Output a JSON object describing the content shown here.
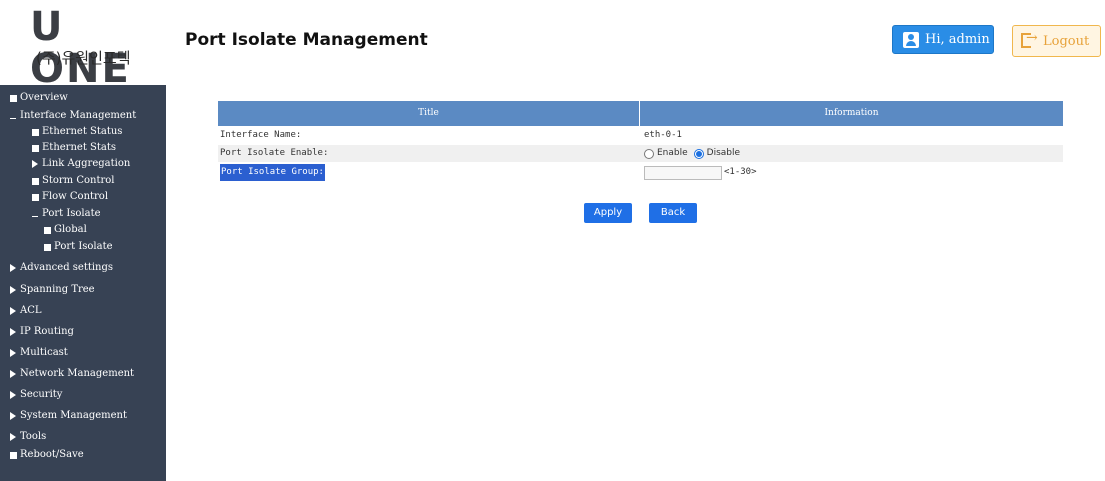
{
  "header": {
    "logo_text": "U ONE",
    "logo_subtitle": "(주)유원인포텍",
    "page_title": "Port Isolate Management",
    "user_button": "Hi, admin",
    "logout_button": "Logout"
  },
  "sidebar": {
    "items": [
      {
        "label": "Overview",
        "marker": "square",
        "level": 0
      },
      {
        "label": "Interface Management",
        "marker": "expanded",
        "level": 0
      },
      {
        "label": "Ethernet Status",
        "marker": "square",
        "level": 1
      },
      {
        "label": "Ethernet Stats",
        "marker": "square",
        "level": 1
      },
      {
        "label": "Link Aggregation",
        "marker": "collapsed",
        "level": 1
      },
      {
        "label": "Storm Control",
        "marker": "square",
        "level": 1
      },
      {
        "label": "Flow Control",
        "marker": "square",
        "level": 1
      },
      {
        "label": "Port Isolate",
        "marker": "expanded",
        "level": 1
      },
      {
        "label": "Global",
        "marker": "square",
        "level": 2
      },
      {
        "label": "Port Isolate",
        "marker": "square",
        "level": 2
      },
      {
        "label": "Advanced settings",
        "marker": "collapsed",
        "level": 0
      },
      {
        "label": "Spanning Tree",
        "marker": "collapsed",
        "level": 0
      },
      {
        "label": "ACL",
        "marker": "collapsed",
        "level": 0
      },
      {
        "label": "IP Routing",
        "marker": "collapsed",
        "level": 0
      },
      {
        "label": "Multicast",
        "marker": "collapsed",
        "level": 0
      },
      {
        "label": "Network Management",
        "marker": "collapsed",
        "level": 0
      },
      {
        "label": "Security",
        "marker": "collapsed",
        "level": 0
      },
      {
        "label": "System Management",
        "marker": "collapsed",
        "level": 0
      },
      {
        "label": "Tools",
        "marker": "collapsed",
        "level": 0
      },
      {
        "label": "Reboot/Save",
        "marker": "square",
        "level": 0
      }
    ]
  },
  "table": {
    "headers": [
      "Title",
      "Information"
    ],
    "rows": {
      "interface_name": {
        "label": "Interface Name:",
        "value": "eth-0-1"
      },
      "port_isolate_enable": {
        "label": "Port Isolate Enable:",
        "options": [
          "Enable",
          "Disable"
        ],
        "selected": "Disable"
      },
      "port_isolate_group": {
        "label": "Port Isolate Group:",
        "value": "",
        "hint": "<1-30>"
      }
    }
  },
  "actions": {
    "apply": "Apply",
    "back": "Back"
  },
  "colors": {
    "sidebar_bg": "#374254",
    "table_header": "#5b8ac3",
    "primary_button": "#1f6fe6",
    "user_button": "#2a8de6",
    "logout_accent": "#f0b74d"
  }
}
